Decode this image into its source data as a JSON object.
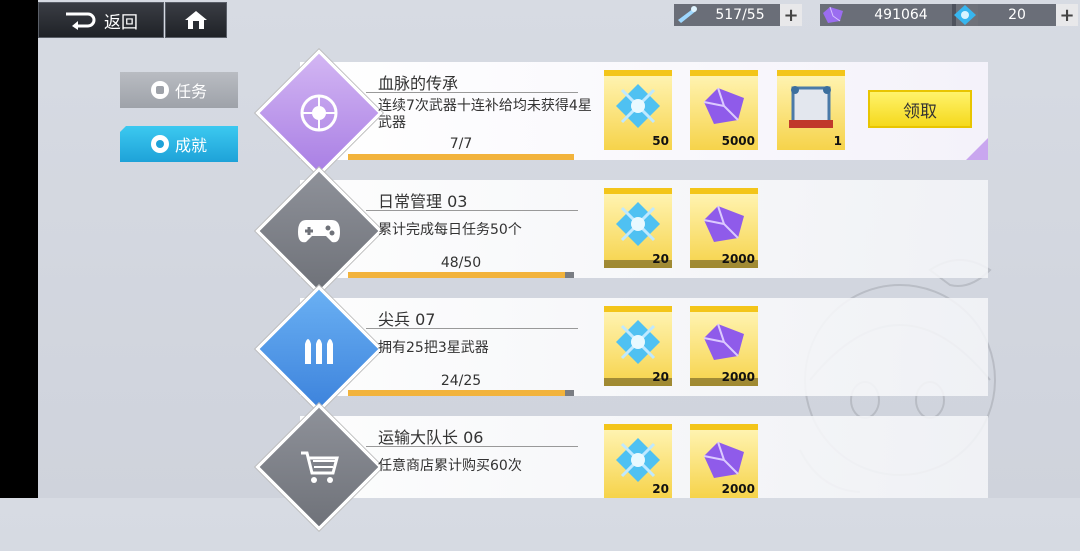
{
  "topbar": {
    "back_label": "返回",
    "resources": [
      {
        "name": "stamina",
        "icon": "crystal-wand-icon",
        "value": "517/55"
      },
      {
        "name": "gems",
        "icon": "purple-gem-icon",
        "value": "491064"
      },
      {
        "name": "cores",
        "icon": "blue-core-icon",
        "value": "20"
      }
    ]
  },
  "tabs": {
    "task": "任务",
    "achievement": "成就"
  },
  "achievements": [
    {
      "title": "血脉的传承",
      "desc": "连续7次武器十连补给均未获得4星武器",
      "progress_text": "7/7",
      "progress": 1.0,
      "icon": "cross-badge-icon",
      "rewards": [
        {
          "icon": "blue-core-icon",
          "qty": "50"
        },
        {
          "icon": "purple-gem-icon",
          "qty": "5000"
        },
        {
          "icon": "frame-icon",
          "qty": "1"
        }
      ],
      "claim_label": "领取"
    },
    {
      "title": "日常管理 03",
      "desc": "累计完成每日任务50个",
      "progress_text": "48/50",
      "progress": 0.96,
      "icon": "gamepad-icon",
      "rewards": [
        {
          "icon": "blue-core-icon",
          "qty": "20"
        },
        {
          "icon": "purple-gem-icon",
          "qty": "2000"
        }
      ]
    },
    {
      "title": "尖兵 07",
      "desc": "拥有25把3星武器",
      "progress_text": "24/25",
      "progress": 0.96,
      "icon": "bullets-icon",
      "rewards": [
        {
          "icon": "blue-core-icon",
          "qty": "20"
        },
        {
          "icon": "purple-gem-icon",
          "qty": "2000"
        }
      ]
    },
    {
      "title": "运输大队长 06",
      "desc": "任意商店累计购买60次",
      "icon": "cart-icon",
      "rewards": [
        {
          "icon": "blue-core-icon",
          "qty": "20"
        },
        {
          "icon": "purple-gem-icon",
          "qty": "2000"
        }
      ]
    }
  ],
  "colors": {
    "accent_blue": "#1ea2d8",
    "claim_yellow": "#f5d91d",
    "progress_orange": "#f2b33c",
    "reward_gold": "#f3c51a"
  }
}
